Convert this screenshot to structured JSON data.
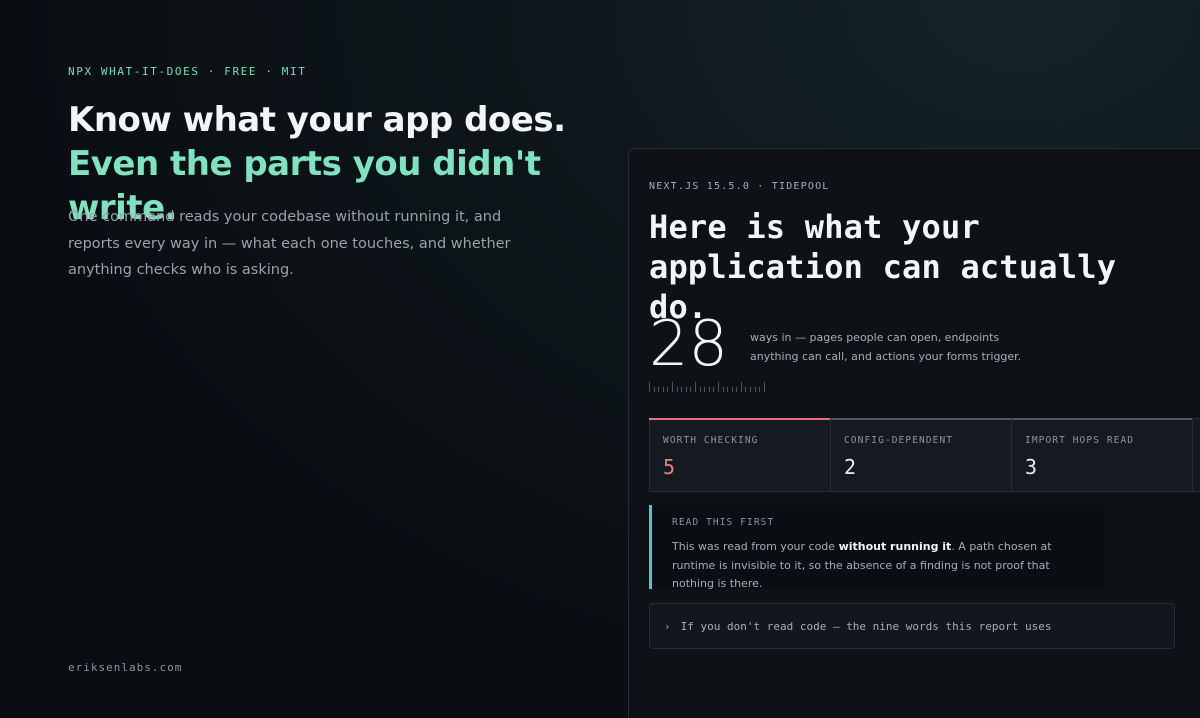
{
  "hero": {
    "eyebrow": "NPX WHAT-IT-DOES · FREE · MIT",
    "headline_line1": "Know what your app does.",
    "headline_line2": "Even the parts you didn't write.",
    "lede": "One command reads your codebase without running it, and reports every way in — what each one touches, and whether anything checks who is asking."
  },
  "footer": {
    "site": "eriksenlabs.com"
  },
  "report": {
    "eyebrow": "NEXT.JS 15.5.0 · TIDEPOOL",
    "title": "Here is what your application can actually do.",
    "count": "28",
    "count_description": "ways in — pages people can open, endpoints anything can call, and actions your forms trigger.",
    "stats": [
      {
        "label": "WORTH CHECKING",
        "value": "5"
      },
      {
        "label": "CONFIG-DEPENDENT",
        "value": "2"
      },
      {
        "label": "IMPORT HOPS READ",
        "value": "3"
      }
    ],
    "callout": {
      "label": "READ THIS FIRST",
      "text_before": "This was read from your code ",
      "text_bold": "without running it",
      "text_after": ". A path chosen at runtime is invisible to it, so the absence of a finding is not proof that nothing is there."
    },
    "disclosure": {
      "chevron": "›",
      "label": "If you don't read code — the nine words this report uses"
    }
  },
  "colors": {
    "accent_green": "#7fe3c0",
    "alert_red": "#ee7a82",
    "callout_cyan": "#4ec3d6"
  }
}
